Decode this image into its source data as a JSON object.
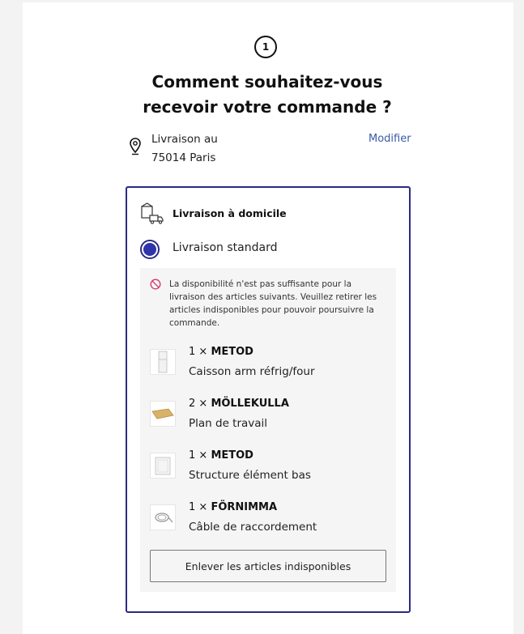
{
  "step": {
    "number": "1"
  },
  "heading": {
    "line1": "Comment souhaitez-vous",
    "line2": "recevoir votre commande ?"
  },
  "address": {
    "label": "Livraison au",
    "city": "75014 Paris",
    "modify_label": "Modifier",
    "icon": "location-pin-icon"
  },
  "delivery": {
    "section_title": "Livraison à domicile",
    "section_icon": "home-delivery-truck-icon",
    "option_label": "Livraison standard",
    "option_selected": true,
    "warning_icon": "unavailable-icon",
    "warning": "La disponibilité n'est pas suffisante pour la livraison des articles suivants. Veuillez retirer les articles indisponibles pour pouvoir poursuivre la commande.",
    "items": [
      {
        "qty": "1 ×",
        "name": "METOD",
        "desc": "Caisson arm réfrig/four",
        "image": "tall-cabinet-image"
      },
      {
        "qty": "2 ×",
        "name": "MÖLLEKULLA",
        "desc": "Plan de travail",
        "image": "worktop-image"
      },
      {
        "qty": "1 ×",
        "name": "METOD",
        "desc": "Structure élément bas",
        "image": "base-cabinet-image"
      },
      {
        "qty": "1 ×",
        "name": "FÖRNIMMA",
        "desc": "Câble de raccordement",
        "image": "cable-image"
      }
    ],
    "remove_label": "Enlever les articles indisponibles"
  },
  "colors": {
    "accent": "#2a2a87",
    "radio_fill": "#2f35a8",
    "link": "#3b5aa8",
    "panel_bg": "#f5f5f5"
  }
}
